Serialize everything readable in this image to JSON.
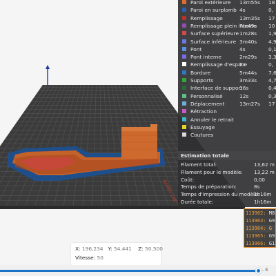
{
  "legend": {
    "items": [
      {
        "name": "Paroi extérieure",
        "time": "13m55s",
        "pct": "18",
        "color": "#e06b2d"
      },
      {
        "name": "Paroi en surplomb",
        "time": "4s",
        "pct": "0,",
        "color": "#2f5fb3"
      },
      {
        "name": "Remplissage",
        "time": "13m35s",
        "pct": "17",
        "color": "#b4342d"
      },
      {
        "name": "Remplissage plein interne",
        "time": "7m49s",
        "pct": "10",
        "color": "#8d4fb0"
      },
      {
        "name": "Surface supérieure",
        "time": "1m28s",
        "pct": "1,9",
        "color": "#d24b4b"
      },
      {
        "name": "Surface inférieure",
        "time": "3m40s",
        "pct": "4,9",
        "color": "#6b7ae0"
      },
      {
        "name": "Pont",
        "time": "4s",
        "pct": "0,1",
        "color": "#5d8fe0"
      },
      {
        "name": "Pont interne",
        "time": "2m29s",
        "pct": "3,3",
        "color": "#7a6ae8"
      },
      {
        "name": "Remplissage d'espace",
        "time": "5s",
        "pct": "0,",
        "color": "#ffffff"
      },
      {
        "name": "Bordure",
        "time": "5m44s",
        "pct": "7,6",
        "color": "#2e78c8"
      },
      {
        "name": "Supports",
        "time": "3m33s",
        "pct": "4,7",
        "color": "#2eaa3a"
      },
      {
        "name": "Interface de support",
        "time": "16s",
        "pct": "0,4",
        "color": "#2a6a38"
      },
      {
        "name": "Personnalisé",
        "time": "12s",
        "pct": "0,3",
        "color": "#5bbf8a"
      },
      {
        "name": "Déplacement",
        "time": "13m27s",
        "pct": "17",
        "color": "#6ab0d8"
      },
      {
        "name": "Rétraction",
        "time": "",
        "pct": "",
        "color": "#c85ac8"
      },
      {
        "name": "Annuler le retrait",
        "time": "",
        "pct": "",
        "color": "#3fb5c8"
      },
      {
        "name": "Essuyage",
        "time": "",
        "pct": "",
        "color": "#e6d42a"
      },
      {
        "name": "Coutures",
        "time": "",
        "pct": "",
        "color": "#d8d8d8"
      }
    ]
  },
  "estimation": {
    "title": "Estimation totale",
    "rows": [
      {
        "label": "Filament total:",
        "value": "13,62 m"
      },
      {
        "label": "Filament pour le modèle:",
        "value": "13,22 m"
      },
      {
        "label": "Coût:",
        "value": "0,00"
      },
      {
        "label": "Temps de préparation:",
        "value": "8s"
      },
      {
        "label": "Temps d'impression du modèle:",
        "value": "1h16m"
      },
      {
        "label": "Durée totale:",
        "value": "1h16m"
      }
    ]
  },
  "gcode": {
    "lines": [
      {
        "num": "113962:",
        "cmd": "M8"
      },
      {
        "num": "113963:",
        "cmd": "G9"
      },
      {
        "num": "113964:",
        "cmd": "G"
      },
      {
        "num": "113965:",
        "cmd": "G9"
      },
      {
        "num": "113966:",
        "cmd": "G1"
      }
    ],
    "active_index": 2
  },
  "coords": {
    "x_label": "X:",
    "x": "196,234",
    "y_label": "Y:",
    "y": "54,441",
    "z_label": "Z:",
    "z": "50,500",
    "speed_label": "Vitesse:",
    "speed": "50"
  },
  "slider": {
    "value": "4",
    "fill_fraction": 0.935
  },
  "colors": {
    "bed_dark": "#3a3a3a",
    "grid_line": "#5a5a5a",
    "border_blue": "#1f4f8a",
    "print_orange": "#c8642a",
    "accent": "#1b74c5"
  },
  "scene_text": {
    "bed_logo": "BAMBU LAB"
  }
}
